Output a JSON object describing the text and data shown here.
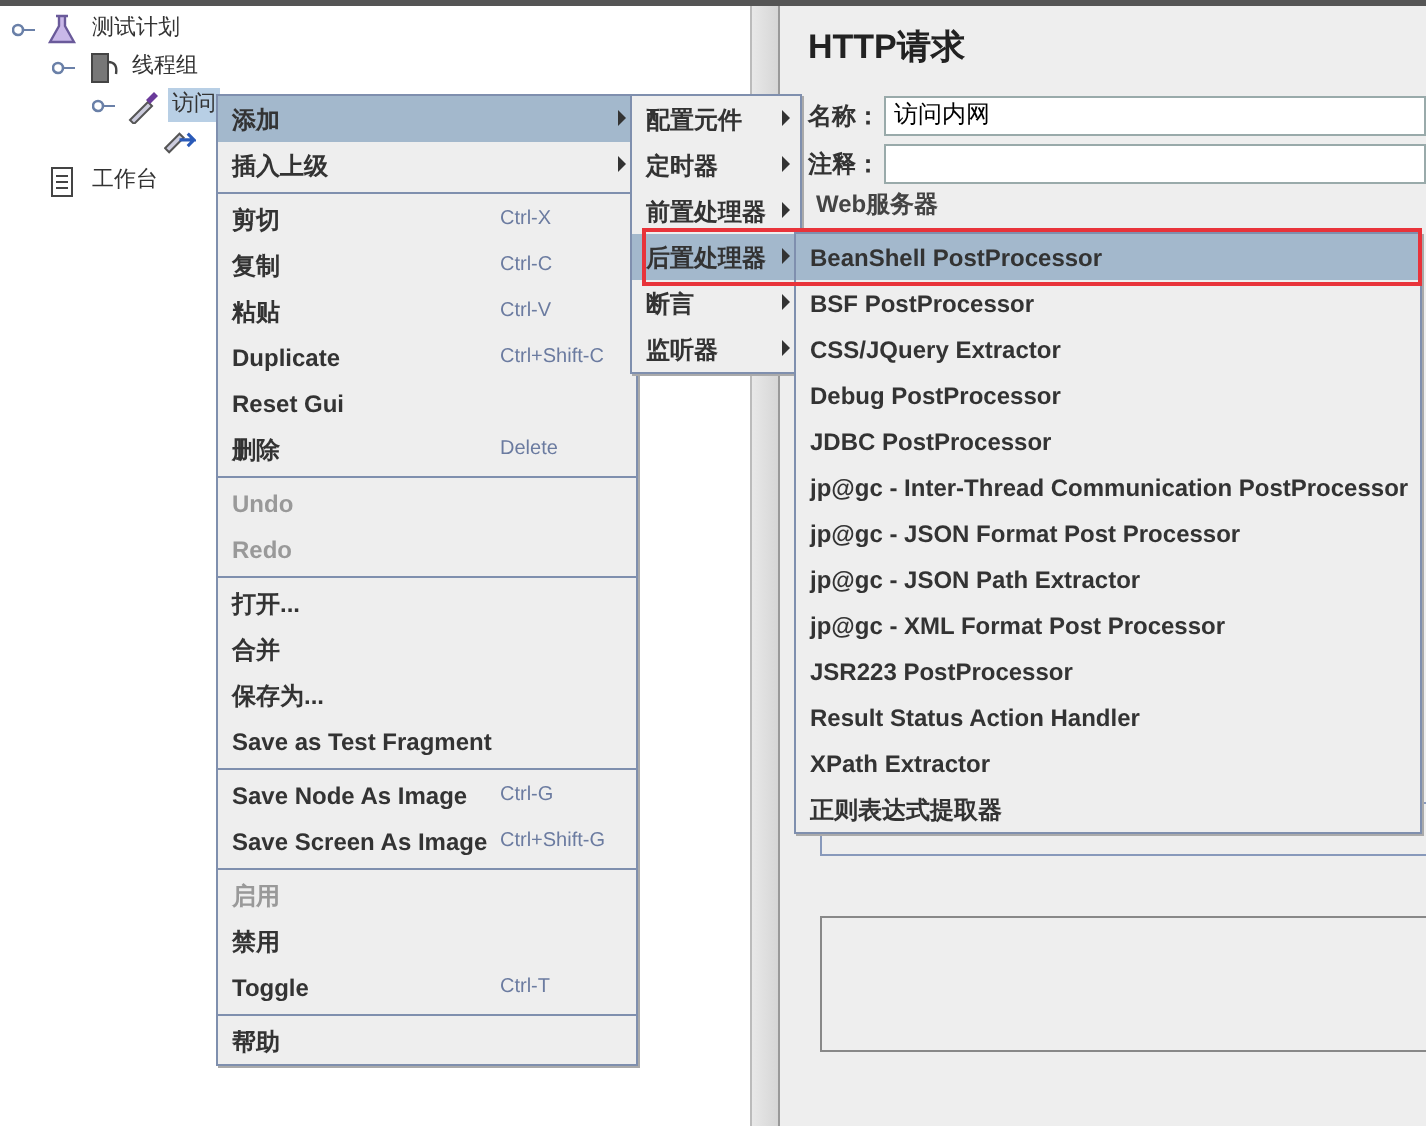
{
  "tree": [
    {
      "kind": "test-plan",
      "label": "测试计划",
      "selected": false,
      "children": [
        {
          "kind": "thread-group",
          "label": "线程组",
          "selected": false,
          "children": [
            {
              "kind": "sampler",
              "label": "访问",
              "selected": true,
              "children": [
                {
                  "kind": "processor",
                  "selected": false
                }
              ]
            }
          ]
        }
      ]
    },
    {
      "kind": "workbench",
      "label": "工作台",
      "selected": false
    }
  ],
  "panel": {
    "title": "HTTP请求",
    "fields": [
      {
        "label": "名称：",
        "value": "访问内网"
      },
      {
        "label": "注释："
      }
    ],
    "group_legend": "Web服务器"
  },
  "context_menu": {
    "items": [
      {
        "kind": "submenu",
        "label": "添加",
        "selected": true,
        "disabled": false
      },
      {
        "kind": "submenu",
        "label": "插入上级",
        "selected": false,
        "disabled": false
      },
      {
        "kind": "separator"
      },
      {
        "kind": "item",
        "label": "剪切",
        "shortcut": "Ctrl-X",
        "selected": false,
        "disabled": false
      },
      {
        "kind": "item",
        "label": "复制",
        "shortcut": "Ctrl-C",
        "selected": false,
        "disabled": false
      },
      {
        "kind": "item",
        "label": "粘贴",
        "shortcut": "Ctrl-V",
        "selected": false,
        "disabled": false
      },
      {
        "kind": "item",
        "label": "Duplicate",
        "shortcut": "Ctrl+Shift-C",
        "selected": false,
        "disabled": false
      },
      {
        "kind": "item",
        "label": "Reset Gui",
        "selected": false,
        "disabled": false
      },
      {
        "kind": "item",
        "label": "删除",
        "shortcut": "Delete",
        "selected": false,
        "disabled": false
      },
      {
        "kind": "separator"
      },
      {
        "kind": "item",
        "label": "Undo",
        "selected": false,
        "disabled": true
      },
      {
        "kind": "item",
        "label": "Redo",
        "selected": false,
        "disabled": true
      },
      {
        "kind": "separator"
      },
      {
        "kind": "item",
        "label": "打开...",
        "selected": false,
        "disabled": false
      },
      {
        "kind": "item",
        "label": "合并",
        "selected": false,
        "disabled": false
      },
      {
        "kind": "item",
        "label": "保存为...",
        "selected": false,
        "disabled": false
      },
      {
        "kind": "item",
        "label": "Save as Test Fragment",
        "selected": false,
        "disabled": false
      },
      {
        "kind": "separator"
      },
      {
        "kind": "item",
        "label": "Save Node As Image",
        "shortcut": "Ctrl-G",
        "selected": false,
        "disabled": false
      },
      {
        "kind": "item",
        "label": "Save Screen As Image",
        "shortcut": "Ctrl+Shift-G",
        "selected": false,
        "disabled": false
      },
      {
        "kind": "separator"
      },
      {
        "kind": "item",
        "label": "启用",
        "selected": false,
        "disabled": true
      },
      {
        "kind": "item",
        "label": "禁用",
        "selected": false,
        "disabled": false
      },
      {
        "kind": "item",
        "label": "Toggle",
        "shortcut": "Ctrl-T",
        "selected": false,
        "disabled": false
      },
      {
        "kind": "separator"
      },
      {
        "kind": "item",
        "label": "帮助",
        "selected": false,
        "disabled": false
      }
    ]
  },
  "add_submenu": {
    "items": [
      {
        "kind": "submenu",
        "label": "配置元件",
        "selected": false
      },
      {
        "kind": "submenu",
        "label": "定时器",
        "selected": false
      },
      {
        "kind": "submenu",
        "label": "前置处理器",
        "selected": false
      },
      {
        "kind": "submenu",
        "label": "后置处理器",
        "selected": true
      },
      {
        "kind": "submenu",
        "label": "断言",
        "selected": false
      },
      {
        "kind": "submenu",
        "label": "监听器",
        "selected": false
      }
    ]
  },
  "postprocessor_submenu": {
    "items": [
      {
        "kind": "item",
        "label": "BeanShell PostProcessor",
        "selected": true
      },
      {
        "kind": "item",
        "label": "BSF PostProcessor",
        "selected": false
      },
      {
        "kind": "item",
        "label": "CSS/JQuery Extractor",
        "selected": false
      },
      {
        "kind": "item",
        "label": "Debug PostProcessor",
        "selected": false
      },
      {
        "kind": "item",
        "label": "JDBC PostProcessor",
        "selected": false
      },
      {
        "kind": "item",
        "label": "jp@gc - Inter-Thread Communication PostProcessor",
        "selected": false
      },
      {
        "kind": "item",
        "label": "jp@gc - JSON Format Post Processor",
        "selected": false
      },
      {
        "kind": "item",
        "label": "jp@gc - JSON Path Extractor",
        "selected": false
      },
      {
        "kind": "item",
        "label": "jp@gc - XML Format Post Processor",
        "selected": false
      },
      {
        "kind": "item",
        "label": "JSR223 PostProcessor",
        "selected": false
      },
      {
        "kind": "item",
        "label": "Result Status Action Handler",
        "selected": false
      },
      {
        "kind": "item",
        "label": "XPath Extractor",
        "selected": false
      },
      {
        "kind": "item",
        "label": "正则表达式提取器",
        "selected": false
      }
    ]
  }
}
